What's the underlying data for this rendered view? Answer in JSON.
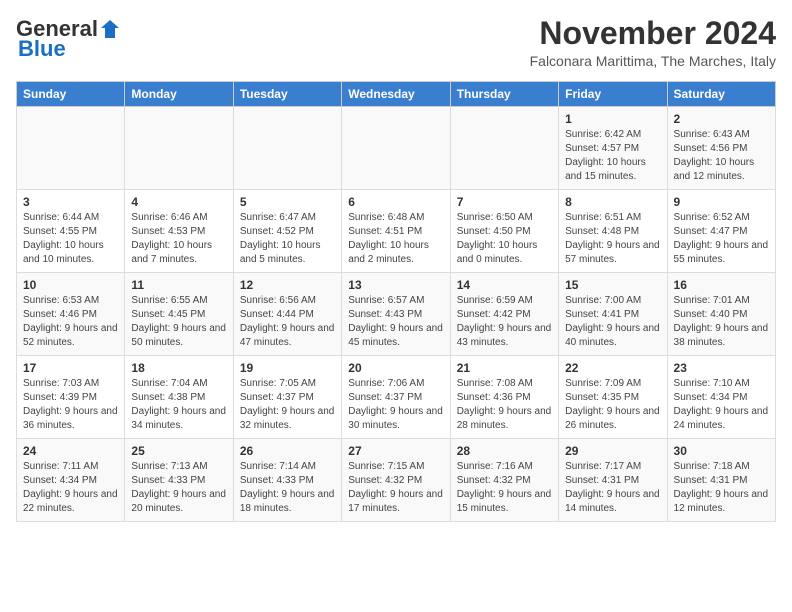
{
  "logo": {
    "text_general": "General",
    "text_blue": "Blue"
  },
  "title": "November 2024",
  "subtitle": "Falconara Marittima, The Marches, Italy",
  "days_of_week": [
    "Sunday",
    "Monday",
    "Tuesday",
    "Wednesday",
    "Thursday",
    "Friday",
    "Saturday"
  ],
  "weeks": [
    [
      {
        "day": "",
        "info": ""
      },
      {
        "day": "",
        "info": ""
      },
      {
        "day": "",
        "info": ""
      },
      {
        "day": "",
        "info": ""
      },
      {
        "day": "",
        "info": ""
      },
      {
        "day": "1",
        "info": "Sunrise: 6:42 AM\nSunset: 4:57 PM\nDaylight: 10 hours and 15 minutes."
      },
      {
        "day": "2",
        "info": "Sunrise: 6:43 AM\nSunset: 4:56 PM\nDaylight: 10 hours and 12 minutes."
      }
    ],
    [
      {
        "day": "3",
        "info": "Sunrise: 6:44 AM\nSunset: 4:55 PM\nDaylight: 10 hours and 10 minutes."
      },
      {
        "day": "4",
        "info": "Sunrise: 6:46 AM\nSunset: 4:53 PM\nDaylight: 10 hours and 7 minutes."
      },
      {
        "day": "5",
        "info": "Sunrise: 6:47 AM\nSunset: 4:52 PM\nDaylight: 10 hours and 5 minutes."
      },
      {
        "day": "6",
        "info": "Sunrise: 6:48 AM\nSunset: 4:51 PM\nDaylight: 10 hours and 2 minutes."
      },
      {
        "day": "7",
        "info": "Sunrise: 6:50 AM\nSunset: 4:50 PM\nDaylight: 10 hours and 0 minutes."
      },
      {
        "day": "8",
        "info": "Sunrise: 6:51 AM\nSunset: 4:48 PM\nDaylight: 9 hours and 57 minutes."
      },
      {
        "day": "9",
        "info": "Sunrise: 6:52 AM\nSunset: 4:47 PM\nDaylight: 9 hours and 55 minutes."
      }
    ],
    [
      {
        "day": "10",
        "info": "Sunrise: 6:53 AM\nSunset: 4:46 PM\nDaylight: 9 hours and 52 minutes."
      },
      {
        "day": "11",
        "info": "Sunrise: 6:55 AM\nSunset: 4:45 PM\nDaylight: 9 hours and 50 minutes."
      },
      {
        "day": "12",
        "info": "Sunrise: 6:56 AM\nSunset: 4:44 PM\nDaylight: 9 hours and 47 minutes."
      },
      {
        "day": "13",
        "info": "Sunrise: 6:57 AM\nSunset: 4:43 PM\nDaylight: 9 hours and 45 minutes."
      },
      {
        "day": "14",
        "info": "Sunrise: 6:59 AM\nSunset: 4:42 PM\nDaylight: 9 hours and 43 minutes."
      },
      {
        "day": "15",
        "info": "Sunrise: 7:00 AM\nSunset: 4:41 PM\nDaylight: 9 hours and 40 minutes."
      },
      {
        "day": "16",
        "info": "Sunrise: 7:01 AM\nSunset: 4:40 PM\nDaylight: 9 hours and 38 minutes."
      }
    ],
    [
      {
        "day": "17",
        "info": "Sunrise: 7:03 AM\nSunset: 4:39 PM\nDaylight: 9 hours and 36 minutes."
      },
      {
        "day": "18",
        "info": "Sunrise: 7:04 AM\nSunset: 4:38 PM\nDaylight: 9 hours and 34 minutes."
      },
      {
        "day": "19",
        "info": "Sunrise: 7:05 AM\nSunset: 4:37 PM\nDaylight: 9 hours and 32 minutes."
      },
      {
        "day": "20",
        "info": "Sunrise: 7:06 AM\nSunset: 4:37 PM\nDaylight: 9 hours and 30 minutes."
      },
      {
        "day": "21",
        "info": "Sunrise: 7:08 AM\nSunset: 4:36 PM\nDaylight: 9 hours and 28 minutes."
      },
      {
        "day": "22",
        "info": "Sunrise: 7:09 AM\nSunset: 4:35 PM\nDaylight: 9 hours and 26 minutes."
      },
      {
        "day": "23",
        "info": "Sunrise: 7:10 AM\nSunset: 4:34 PM\nDaylight: 9 hours and 24 minutes."
      }
    ],
    [
      {
        "day": "24",
        "info": "Sunrise: 7:11 AM\nSunset: 4:34 PM\nDaylight: 9 hours and 22 minutes."
      },
      {
        "day": "25",
        "info": "Sunrise: 7:13 AM\nSunset: 4:33 PM\nDaylight: 9 hours and 20 minutes."
      },
      {
        "day": "26",
        "info": "Sunrise: 7:14 AM\nSunset: 4:33 PM\nDaylight: 9 hours and 18 minutes."
      },
      {
        "day": "27",
        "info": "Sunrise: 7:15 AM\nSunset: 4:32 PM\nDaylight: 9 hours and 17 minutes."
      },
      {
        "day": "28",
        "info": "Sunrise: 7:16 AM\nSunset: 4:32 PM\nDaylight: 9 hours and 15 minutes."
      },
      {
        "day": "29",
        "info": "Sunrise: 7:17 AM\nSunset: 4:31 PM\nDaylight: 9 hours and 14 minutes."
      },
      {
        "day": "30",
        "info": "Sunrise: 7:18 AM\nSunset: 4:31 PM\nDaylight: 9 hours and 12 minutes."
      }
    ]
  ]
}
